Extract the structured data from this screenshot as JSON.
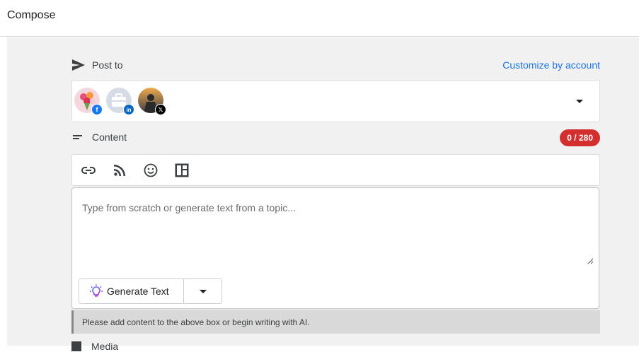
{
  "header": {
    "title": "Compose"
  },
  "post_to": {
    "label": "Post to",
    "customize_link": "Customize by account",
    "accounts": [
      {
        "network": "facebook",
        "badge": "f",
        "badge_color": "#1877f2"
      },
      {
        "network": "linkedin",
        "badge": "in",
        "badge_color": "#0a66c2"
      },
      {
        "network": "x",
        "badge": "𝕏",
        "badge_color": "#000000"
      }
    ]
  },
  "content": {
    "label": "Content",
    "counter": "0 / 280",
    "counter_color": "#d32f2f",
    "placeholder": "Type from scratch or generate text from a topic...",
    "generate_label": "Generate Text",
    "notice": "Please add content to the above box or begin writing with AI."
  },
  "media": {
    "label": "Media"
  },
  "colors": {
    "link": "#1a73e8",
    "panel_bg": "#f1f1f1"
  }
}
